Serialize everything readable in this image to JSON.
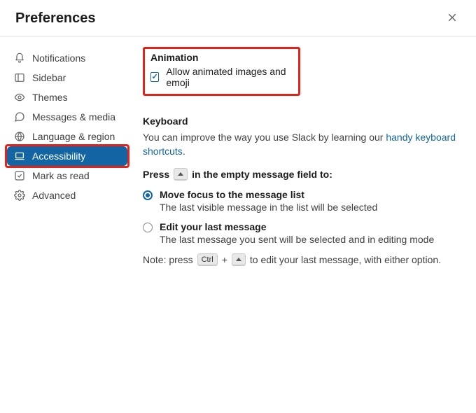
{
  "header": {
    "title": "Preferences"
  },
  "sidebar": {
    "items": [
      {
        "id": "notifications",
        "label": "Notifications"
      },
      {
        "id": "sidebar",
        "label": "Sidebar"
      },
      {
        "id": "themes",
        "label": "Themes"
      },
      {
        "id": "messages",
        "label": "Messages & media"
      },
      {
        "id": "language",
        "label": "Language & region"
      },
      {
        "id": "accessibility",
        "label": "Accessibility"
      },
      {
        "id": "markasread",
        "label": "Mark as read"
      },
      {
        "id": "advanced",
        "label": "Advanced"
      }
    ],
    "active_index": 5
  },
  "animation": {
    "title": "Animation",
    "checkbox_label": "Allow animated images and emoji",
    "checked": true
  },
  "keyboard": {
    "title": "Keyboard",
    "desc_prefix": "You can improve the way you use Slack by learning our ",
    "link_text": "handy keyboard shortcuts",
    "link_period": ".",
    "press_before": "Press",
    "press_after": "in the empty message field to:",
    "options": [
      {
        "label": "Move focus to the message list",
        "sub": "The last visible message in the list will be selected",
        "selected": true
      },
      {
        "label": "Edit your last message",
        "sub": "The last message you sent will be selected and in editing mode",
        "selected": false
      }
    ],
    "note_prefix": "Note: press",
    "note_ctrl": "Ctrl",
    "note_plus": "+",
    "note_suffix": "to edit your last message, with either option."
  }
}
